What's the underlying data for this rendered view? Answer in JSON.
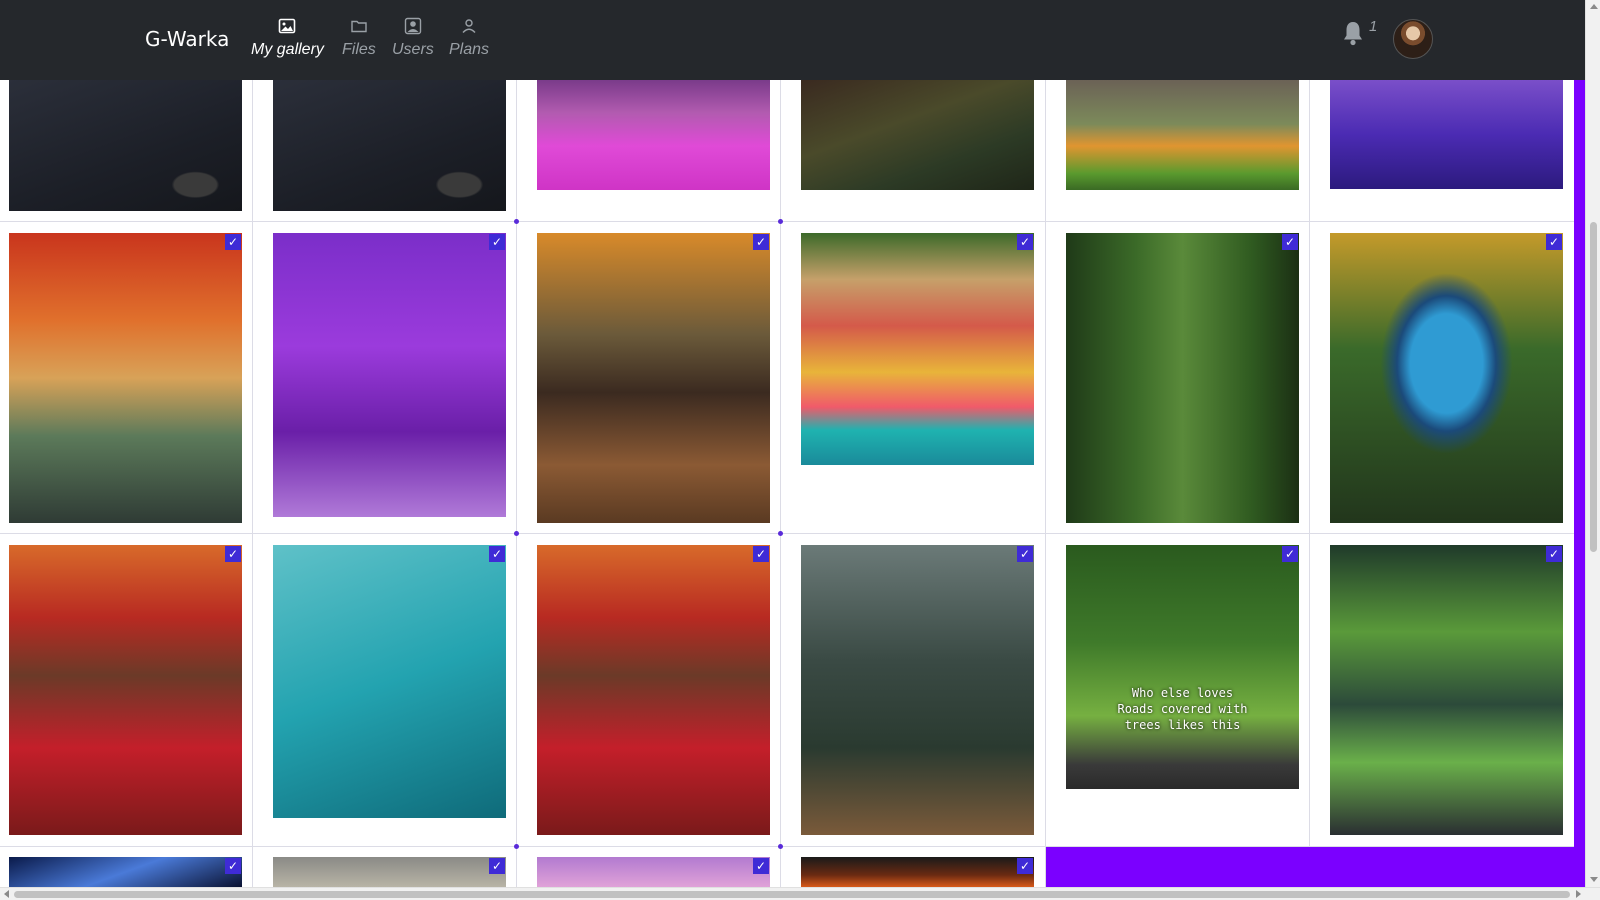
{
  "navbar": {
    "brand": "G-Warka",
    "items": [
      {
        "label": "My gallery",
        "icon": "image-icon",
        "active": true
      },
      {
        "label": "Files",
        "icon": "folder-icon",
        "active": false
      },
      {
        "label": "Users",
        "icon": "user-square-icon",
        "active": false
      },
      {
        "label": "Plans",
        "icon": "user-icon",
        "active": false
      }
    ],
    "notifications_count": "1",
    "avatar_icon": "user-avatar"
  },
  "gallery": {
    "accent_color": "#7b00ff",
    "check_color": "#3f2bd6",
    "check_mark": "✓",
    "tiles": [
      {
        "subject": "black shirt with chip logo",
        "selected": false
      },
      {
        "subject": "black shirt with chip logo",
        "selected": false
      },
      {
        "subject": "pink flower field",
        "selected": false
      },
      {
        "subject": "garden path",
        "selected": false
      },
      {
        "subject": "stone stairs with flowers",
        "selected": false
      },
      {
        "subject": "purple river",
        "selected": false
      },
      {
        "subject": "autumn van with coffee",
        "selected": true
      },
      {
        "subject": "jacaranda street",
        "selected": true
      },
      {
        "subject": "glass cabin interior",
        "selected": true
      },
      {
        "subject": "colorful village houses",
        "selected": true
      },
      {
        "subject": "green canyon waterfall",
        "selected": true
      },
      {
        "subject": "forest blue lake",
        "selected": true
      },
      {
        "subject": "red autumn hut",
        "selected": true
      },
      {
        "subject": "overgrown shipwreck",
        "selected": true
      },
      {
        "subject": "red autumn hut",
        "selected": true
      },
      {
        "subject": "cliff elevator tower",
        "selected": true
      },
      {
        "subject": "tree tunnel road",
        "selected": true,
        "overlay_text": "Who else loves\nRoads covered with\ntrees likes this"
      },
      {
        "subject": "green terraced building",
        "selected": true
      },
      {
        "subject": "space aurora",
        "selected": true
      },
      {
        "subject": "cloudy sky",
        "selected": true
      },
      {
        "subject": "pink blossom tree",
        "selected": true
      },
      {
        "subject": "fiery landscape",
        "selected": true
      }
    ]
  }
}
